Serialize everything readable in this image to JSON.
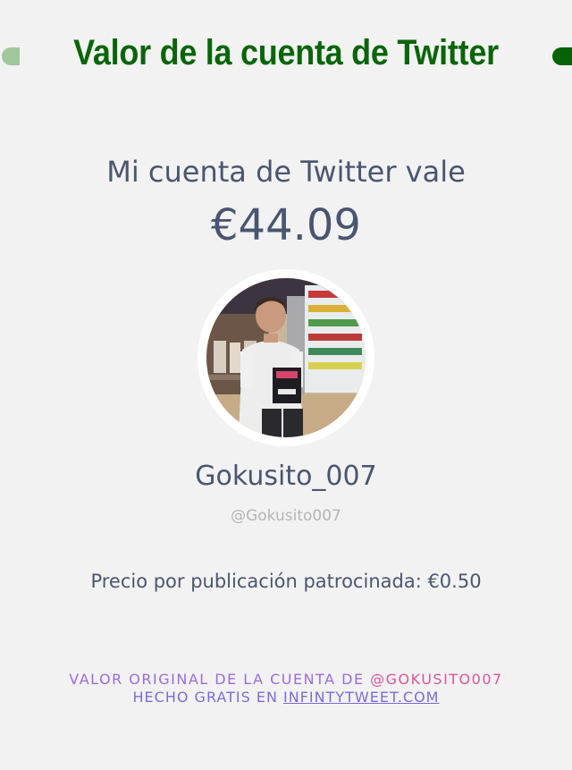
{
  "header": {
    "title": "Valor de la cuenta de Twitter"
  },
  "main": {
    "subtitle": "Mi cuenta de Twitter vale",
    "value": "€44.09",
    "avatar_icon": "profile-photo",
    "name": "Gokusito_007",
    "handle": "@Gokusito007",
    "price_text": "Precio por publicación patrocinada: €0.50"
  },
  "footer": {
    "line1_prefix": "VALOR ORIGINAL DE LA CUENTA DE",
    "line1_handle": "@GOKUSITO007",
    "line2_prefix": "HECHO GRATIS EN",
    "line2_link": "INFINTYTWEET.COM"
  },
  "colors": {
    "background": "#f2f2f2",
    "title_green": "#0a650a",
    "text_slate": "#4a5670",
    "handle_gray": "#b5b5b5",
    "footer_purple": "#9b6cdc",
    "footer_pink": "#d9569a",
    "footer_blue": "#7e6ad8"
  }
}
